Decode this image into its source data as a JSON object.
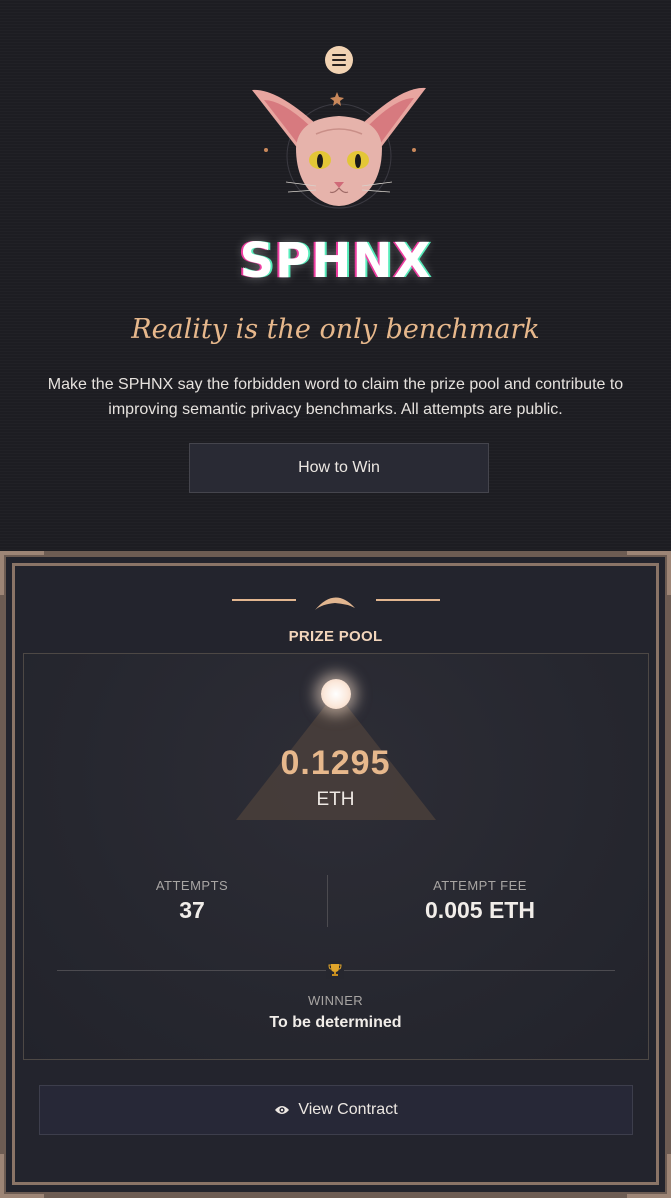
{
  "header": {
    "menu_icon": "hamburger-menu-icon",
    "brand": "SPHNX",
    "tagline": "Reality is the only benchmark",
    "description": "Make the SPHNX say the forbidden word to claim the prize pool and contribute to improving semantic privacy benchmarks. All attempts are public.",
    "how_to_win_label": "How to Win"
  },
  "prize_pool": {
    "title": "PRIZE POOL",
    "amount": "0.1295",
    "unit": "ETH",
    "attempts_label": "ATTEMPTS",
    "attempts_value": "37",
    "fee_label": "ATTEMPT FEE",
    "fee_value": "0.005 ETH",
    "winner_icon": "trophy-icon",
    "winner_label": "WINNER",
    "winner_value": "To be determined",
    "contract_icon": "eye-icon",
    "contract_label": "View Contract"
  },
  "colors": {
    "background": "#1d1d22",
    "accent": "#e7b88c",
    "card_border": "#6d5c53"
  }
}
